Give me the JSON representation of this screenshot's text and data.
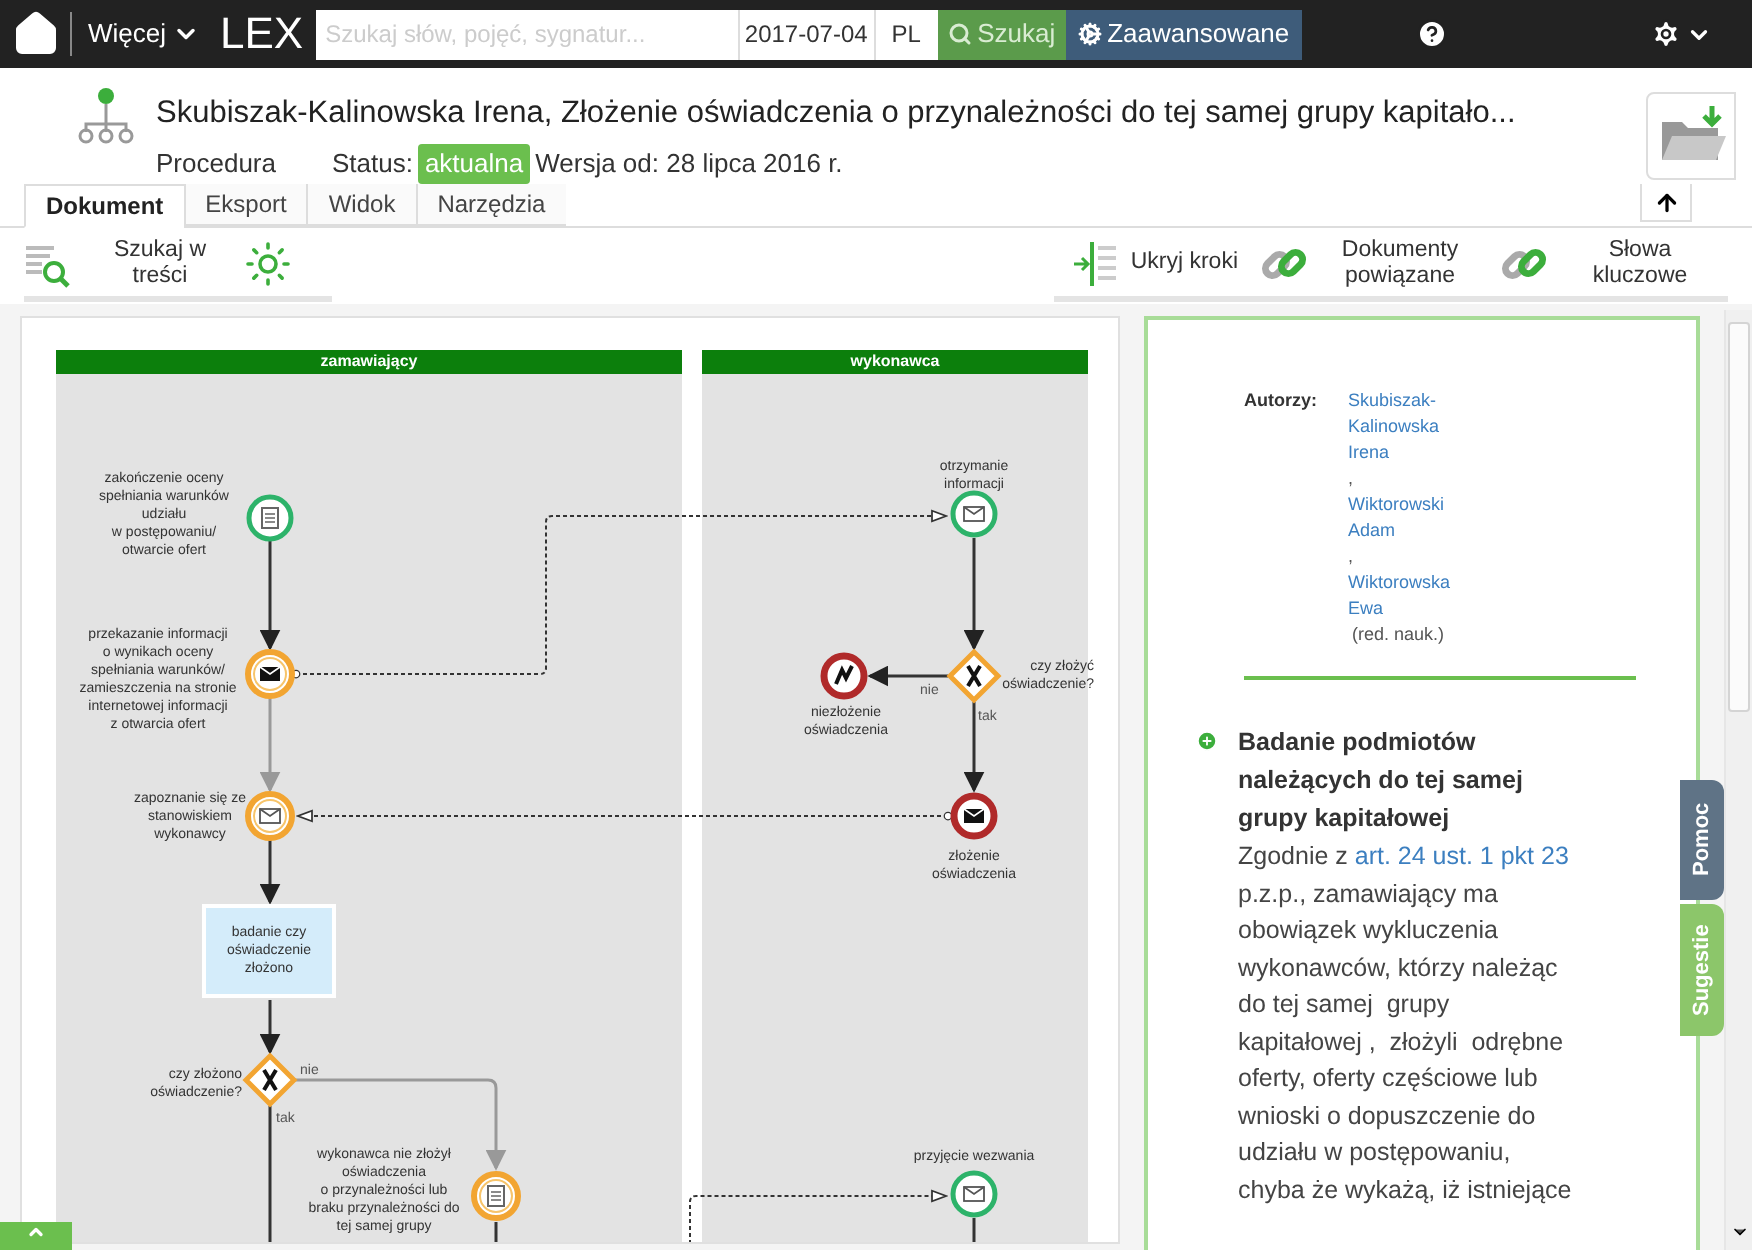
{
  "top_bar": {
    "menu": "Więcej",
    "logo": "LEX",
    "search": {
      "placeholder": "Szukaj słów, pojęć, sygnatur..."
    },
    "date": "2017-07-04",
    "language": "PL",
    "search_button": "Szukaj",
    "advanced_button": "Zaawansowane"
  },
  "document": {
    "title": "Skubiszak-Kalinowska Irena, Złożenie oświadczenia o przynależności do tej samej grupy kapitało...",
    "type": "Procedura",
    "status_label": "Status:",
    "status": "aktualna",
    "version": "Wersja od: 28 lipca 2016 r."
  },
  "tabs": [
    {
      "label": "Dokument",
      "selected": true
    },
    {
      "label": "Eksport",
      "selected": false
    },
    {
      "label": "Widok",
      "selected": false
    },
    {
      "label": "Narzędzia",
      "selected": false
    }
  ],
  "toolbar": {
    "search_in_text": "Szukaj w treści",
    "right": [
      {
        "kind": "collapse",
        "label": "Ukryj kroki"
      },
      {
        "kind": "link",
        "label": "Dokumenty powiązane"
      },
      {
        "kind": "link",
        "label": "Słowa kluczowe"
      }
    ]
  },
  "diagram": {
    "lanes": [
      {
        "title": "zamawiający"
      },
      {
        "title": "wykonawca"
      }
    ],
    "nodes": [
      {
        "kind": "doc-start",
        "label": "zakończenie oceny\nspełniania warunków\nudziału\nw postępowaniu/\notwarcie ofert"
      },
      {
        "kind": "msg-throw",
        "label": "przekazanie informacji\no wynikach oceny\nspełniania warunków/\nzamieszczenia na stronie\ninternetowej informacji\nz otwarcia ofert"
      },
      {
        "kind": "msg-catch",
        "label": "zapoznanie się ze\nstanowiskiem\nwykonawcy"
      },
      {
        "kind": "task",
        "label": "badanie czy\noświadczenie\nzłożono"
      },
      {
        "kind": "gateway",
        "label": "czy złożono\noświadczenie?",
        "no": "nie",
        "yes": "tak"
      },
      {
        "kind": "doc-intermediate",
        "label": "wykonawca nie złożył\noświadczenia\no przynależności lub\nbraku przynależności do\ntej samej grupy"
      },
      {
        "kind": "msg-start",
        "label": "otrzymanie\ninformacji"
      },
      {
        "kind": "gateway",
        "label": "czy złożyć\noświadczenie?",
        "no": "nie",
        "yes": "tak"
      },
      {
        "kind": "error-end",
        "label": "niezłożenie\noświadczenia"
      },
      {
        "kind": "msg-end",
        "label": "złożenie\noświadczenia"
      },
      {
        "kind": "msg-start",
        "label": "przyjęcie wezwania"
      }
    ]
  },
  "info": {
    "authors_label": "Autorzy:",
    "authors": [
      {
        "name": "Skubiszak-Kalinowska Irena",
        "separator": ","
      },
      {
        "name": "Wiktorowski Adam",
        "separator": ","
      },
      {
        "name": "Wiktorowska Ewa"
      }
    ],
    "editor_note": "(red. nauk.)",
    "heading": "Badanie podmiotów należących do tej samej grupy kapitałowej",
    "text_before": "Zgodnie z",
    "link": "art. 24 ust. 1 pkt 23",
    "text_after": "p.z.p., zamawiający ma obowiązek wykluczenia wykonawców, którzy należąc do tej samej  grupy kapitałowej ,  złożyli  odrębne oferty, oferty częściowe lub wnioski o dopuszczenie do udziału w postępowaniu, chyba że wykażą, iż istniejące"
  },
  "side_tabs": [
    {
      "kind": "help",
      "label": "Pomoc"
    },
    {
      "kind": "suggest",
      "label": "Sugestie"
    }
  ]
}
